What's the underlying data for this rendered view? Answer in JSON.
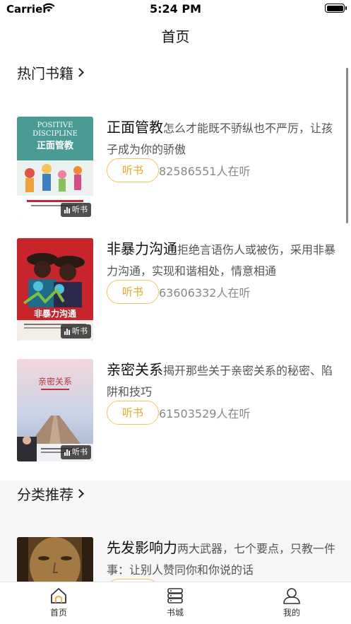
{
  "status_bar": {
    "carrier": "Carrier",
    "time": "5:24 PM"
  },
  "nav": {
    "title": "首页"
  },
  "sections": {
    "hot_books": "热门书籍",
    "category_recommend": "分类推荐"
  },
  "books": [
    {
      "title": "正面管教",
      "description": "怎么才能既不骄纵也不严厉，让孩子成为你的骄傲",
      "listen_label": "听书",
      "listeners": "82586551人在听",
      "cover_badge": "听书",
      "cover": {
        "line1": "POSITIVE",
        "line2": "DISCIPLINE",
        "cn": "正面管教",
        "bg": "#4a9b93"
      }
    },
    {
      "title": "非暴力沟通",
      "description": "拒绝言语伤人或被伤，采用非暴力沟通，实现和谐相处，情意相通",
      "listen_label": "听书",
      "listeners": "63606332人在听",
      "cover_badge": "听书",
      "cover": {
        "cn": "非暴力沟通",
        "bg": "#c8242b"
      }
    },
    {
      "title": "亲密关系",
      "description": "揭开那些关于亲密关系的秘密、陷阱和技巧",
      "listen_label": "听书",
      "listeners": "61503529人在听",
      "cover_badge": "听书",
      "cover": {
        "cn": "亲密关系",
        "bg": "#d9dce6"
      }
    },
    {
      "title": "先发影响力",
      "description": "两大武器，七个要点，只教一件事：让别人赞同你和你说的话"
    }
  ],
  "tabs": [
    {
      "label": "首页",
      "icon": "home-icon",
      "active": true
    },
    {
      "label": "书城",
      "icon": "bookstore-icon",
      "active": false
    },
    {
      "label": "我的",
      "icon": "profile-icon",
      "active": false
    }
  ],
  "colors": {
    "accent": "#e7a826",
    "accent_border": "#f2c55c",
    "scroll_indicator": "#8a8a8a"
  }
}
